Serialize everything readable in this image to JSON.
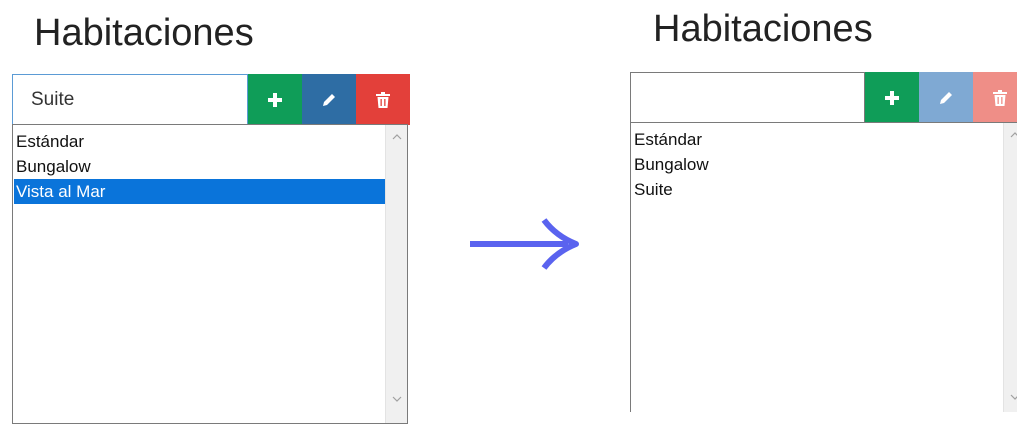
{
  "before": {
    "title": "Habitaciones",
    "input_value": "Suite",
    "items": [
      {
        "label": "Estándar"
      },
      {
        "label": "Bungalow"
      },
      {
        "label": "Vista al Mar",
        "selected": true
      }
    ]
  },
  "after": {
    "title": "Habitaciones",
    "input_value": "",
    "items": [
      {
        "label": "Estándar"
      },
      {
        "label": "Bungalow"
      },
      {
        "label": "Suite"
      }
    ]
  },
  "icons": {
    "add": "plus-icon",
    "edit": "pencil-icon",
    "delete": "trash-icon",
    "transition": "right-arrow-icon"
  },
  "colors": {
    "add": "#0f9d58",
    "edit_active": "#2e6da4",
    "edit_disabled": "#7fa9d3",
    "delete_active": "#e3403a",
    "delete_disabled": "#ef8e87",
    "selection": "#0a74da",
    "arrow": "#5a63ef"
  }
}
